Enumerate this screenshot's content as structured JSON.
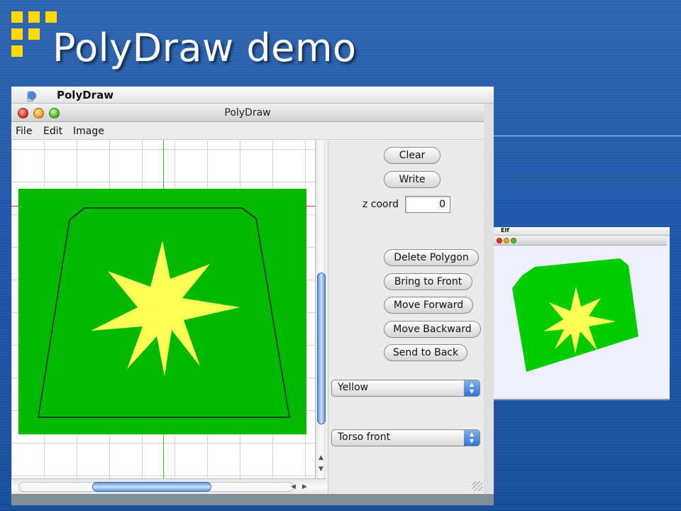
{
  "slide": {
    "title": "PolyDraw demo"
  },
  "colors": {
    "canvas_green": "#00b800",
    "star_yellow": "#ffff55",
    "accent_blue": "#2f73d2"
  },
  "menubar": {
    "app_name": "PolyDraw",
    "apple_icon": "apple-icon"
  },
  "window": {
    "title": "PolyDraw"
  },
  "window_menu": [
    {
      "label": "File"
    },
    {
      "label": "Edit"
    },
    {
      "label": "Image"
    }
  ],
  "panel": {
    "clear_label": "Clear",
    "write_label": "Write",
    "z_label": "z coord",
    "z_value": "0",
    "delete_label": "Delete Polygon",
    "bring_front_label": "Bring to Front",
    "move_forward_label": "Move Forward",
    "move_backward_label": "Move Backward",
    "send_back_label": "Send to Back",
    "color_select": "Yellow",
    "part_select": "Torso front"
  },
  "elf": {
    "app_name": "Elf"
  }
}
